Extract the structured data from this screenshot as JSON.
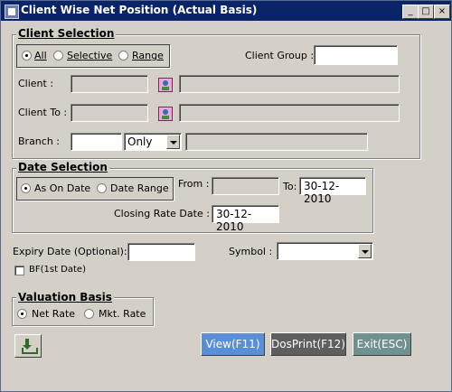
{
  "window": {
    "title": "Client Wise Net Position (Actual Basis)",
    "minimize": "_",
    "maximize": "□",
    "close": "×"
  },
  "client_selection": {
    "heading": "Client Selection",
    "options": [
      "All",
      "Selective",
      "Range"
    ],
    "selected": "All",
    "client_group_label": "Client Group :",
    "client_group_value": "",
    "client_label": "Client :",
    "client_to_label": "Client To :",
    "branch_label": "Branch :",
    "branch_value": "",
    "branch_mode": "Only"
  },
  "date_selection": {
    "heading": "Date Selection",
    "options": [
      "As On Date",
      "Date Range"
    ],
    "selected": "As On Date",
    "from_label": "From :",
    "from_value": "",
    "to_label": "To:",
    "to_value": "30-12-2010",
    "closing_rate_label": "Closing Rate Date :",
    "closing_rate_value": "30-12-2010"
  },
  "expiry": {
    "label": "Expiry Date (Optional):",
    "value": ""
  },
  "symbol": {
    "label": "Symbol :",
    "value": ""
  },
  "bf": {
    "label": "BF(1st Date)",
    "checked": false
  },
  "valuation": {
    "heading": "Valuation Basis",
    "options": [
      "Net Rate",
      "Mkt. Rate"
    ],
    "selected": "Net Rate"
  },
  "buttons": {
    "view": "View(F11)",
    "dosprint": "DosPrint(F12)",
    "exit": "Exit(ESC)"
  },
  "colors": {
    "view_bg": "#5b8ed8",
    "dosprint_bg": "#5e5e5e",
    "exit_bg": "#6f9190",
    "titlebar": "#0a246a",
    "window_bg": "#d4d0c8"
  }
}
